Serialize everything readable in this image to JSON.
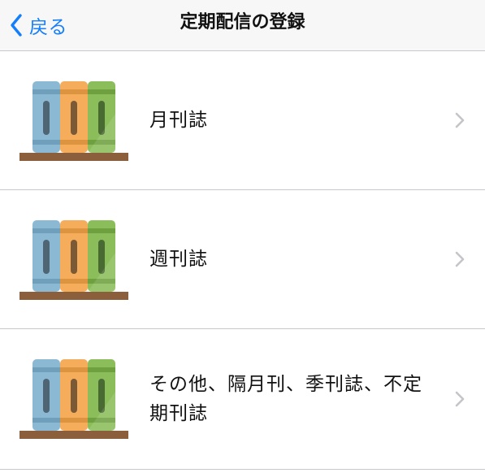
{
  "nav": {
    "back_label": "戻る",
    "title": "定期配信の登録"
  },
  "list": {
    "items": [
      {
        "label": "月刊誌",
        "icon": "books-on-shelf-icon"
      },
      {
        "label": "週刊誌",
        "icon": "books-on-shelf-icon"
      },
      {
        "label": "その他、隔月刊、季刊誌、不定期刊誌",
        "icon": "books-on-shelf-icon"
      }
    ]
  },
  "colors": {
    "accent": "#147efb",
    "book_blue": "#8bb9d3",
    "book_orange": "#f5ad5b",
    "book_green": "#8bbd5a",
    "shelf": "#8b5e3c"
  }
}
